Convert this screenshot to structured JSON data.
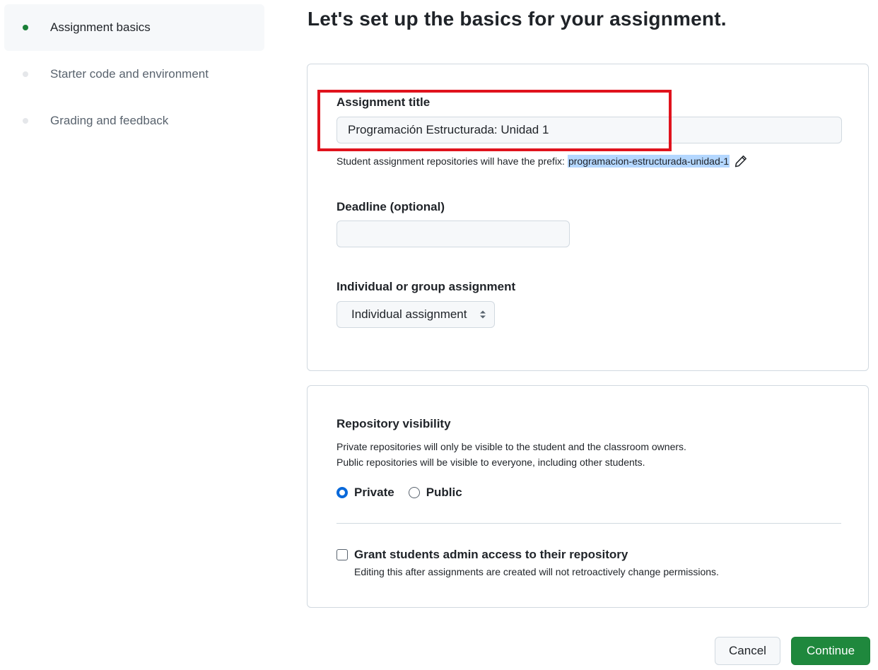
{
  "sidebar": {
    "steps": [
      {
        "label": "Assignment basics",
        "active": true
      },
      {
        "label": "Starter code and environment",
        "active": false
      },
      {
        "label": "Grading and feedback",
        "active": false
      }
    ]
  },
  "page_title": "Let's set up the basics for your assignment.",
  "basics": {
    "title_label": "Assignment title",
    "title_value": "Programación Estructurada: Unidad 1",
    "prefix_hint": "Student assignment repositories will have the prefix:",
    "prefix_value": "programacion-estructurada-unidad-1",
    "deadline_label": "Deadline (optional)",
    "deadline_value": "",
    "type_label": "Individual or group assignment",
    "type_selected": "Individual assignment"
  },
  "visibility": {
    "label": "Repository visibility",
    "desc_line1": "Private repositories will only be visible to the student and the classroom owners.",
    "desc_line2": "Public repositories will be visible to everyone, including other students.",
    "options": [
      {
        "label": "Private",
        "checked": true
      },
      {
        "label": "Public",
        "checked": false
      }
    ],
    "admin_label": "Grant students admin access to their repository",
    "admin_desc": "Editing this after assignments are created will not retroactively change permissions.",
    "admin_checked": false
  },
  "actions": {
    "cancel_label": "Cancel",
    "continue_label": "Continue"
  },
  "colors": {
    "accent_green": "#1f883d",
    "active_dot": "#1a7f37",
    "radio_blue": "#0969da",
    "annotation_red": "#e0131d",
    "prefix_highlight": "#b4d7ff"
  }
}
